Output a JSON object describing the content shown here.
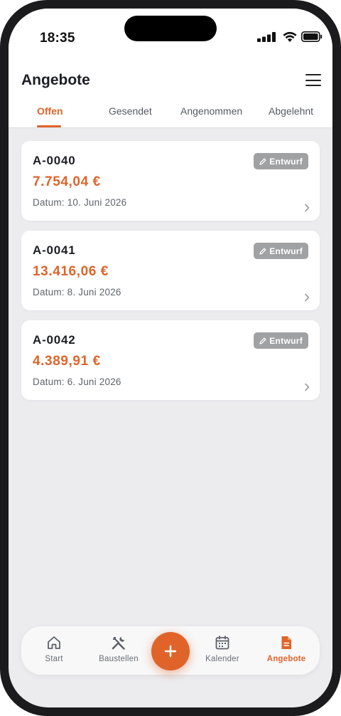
{
  "status_bar": {
    "time": "18:35"
  },
  "header": {
    "title": "Angebote"
  },
  "tabs": [
    {
      "label": "Offen",
      "active": true
    },
    {
      "label": "Gesendet",
      "active": false
    },
    {
      "label": "Angenommen",
      "active": false
    },
    {
      "label": "Abgelehnt",
      "active": false
    }
  ],
  "offers": [
    {
      "number": "A-0040",
      "amount": "7.754,04 €",
      "date": "Datum: 10. Juni 2026",
      "status": "Entwurf"
    },
    {
      "number": "A-0041",
      "amount": "13.416,06 €",
      "date": "Datum: 8. Juni 2026",
      "status": "Entwurf"
    },
    {
      "number": "A-0042",
      "amount": "4.389,91 €",
      "date": "Datum: 6. Juni 2026",
      "status": "Entwurf"
    }
  ],
  "bottom_nav": {
    "items": [
      {
        "label": "Start",
        "icon": "home-icon",
        "active": false
      },
      {
        "label": "Baustellen",
        "icon": "tools-icon",
        "active": false
      },
      {
        "label": "Kalender",
        "icon": "calendar-icon",
        "active": false
      },
      {
        "label": "Angebote",
        "icon": "document-icon",
        "active": true
      }
    ],
    "fab_icon": "plus-icon"
  },
  "colors": {
    "accent": "#e0642a",
    "badge": "#a0a1a3",
    "background": "#ececef"
  }
}
